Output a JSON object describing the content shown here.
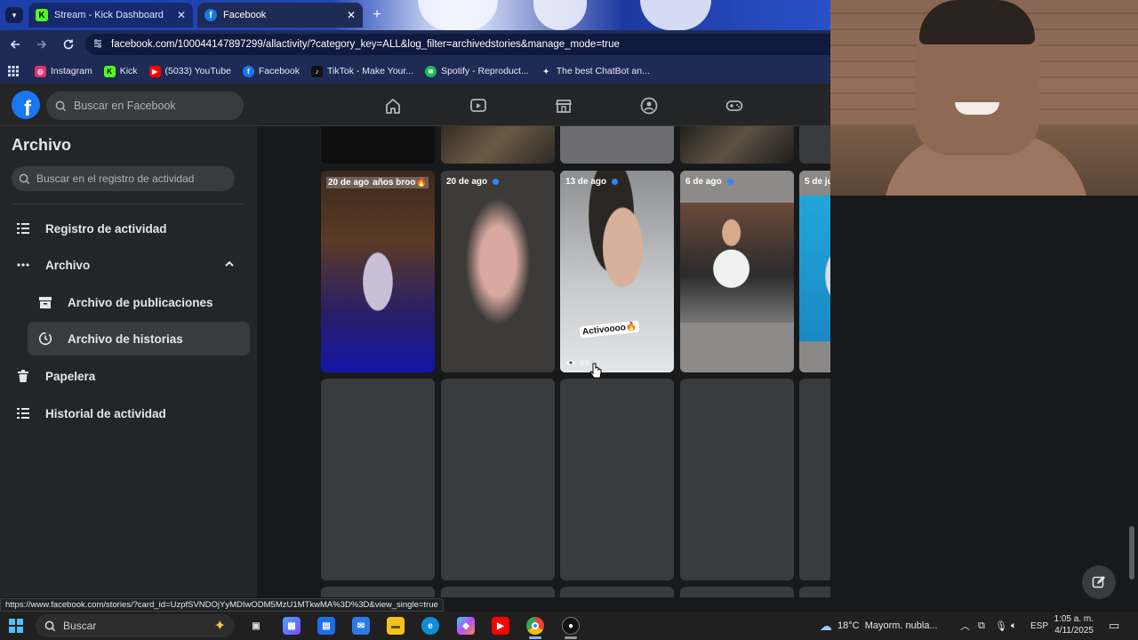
{
  "browser": {
    "tabs": [
      {
        "label": "Stream - Kick Dashboard",
        "active": false
      },
      {
        "label": "Facebook",
        "active": true
      }
    ],
    "url": "facebook.com/100044147897299/allactivity/?category_key=ALL&log_filter=archivedstories&manage_mode=true",
    "bookmarks": [
      {
        "label": "Instagram",
        "icon": "instagram-icon",
        "color": "#e1306c"
      },
      {
        "label": "Kick",
        "icon": "kick-icon",
        "color": "#53fc18"
      },
      {
        "label": "(5033) YouTube",
        "icon": "youtube-icon",
        "color": "#ff0000"
      },
      {
        "label": "Facebook",
        "icon": "facebook-icon",
        "color": "#1877f2"
      },
      {
        "label": "TikTok - Make Your...",
        "icon": "tiktok-icon",
        "color": "#111111"
      },
      {
        "label": "Spotify - Reproduct...",
        "icon": "spotify-icon",
        "color": "#1db954"
      },
      {
        "label": "The best ChatBot an...",
        "icon": "chatbot-icon",
        "color": "#444444"
      }
    ],
    "status_url": "https://www.facebook.com/stories/?card_id=UzpfSVNDOjYyMDIwODM5MzU1MTkwMA%3D%3D&view_single=true"
  },
  "facebook": {
    "search_placeholder": "Buscar en Facebook",
    "nav_icons": [
      "home-icon",
      "watch-icon",
      "marketplace-icon",
      "groups-icon",
      "gaming-icon"
    ],
    "accent": "#1877f2"
  },
  "sidebar": {
    "title": "Archivo",
    "search_placeholder": "Buscar en el registro de actividad",
    "items": [
      {
        "label": "Registro de actividad",
        "icon": "list-icon"
      },
      {
        "label": "Archivo",
        "icon": "more-icon"
      },
      {
        "label": "Archivo de publicaciones",
        "icon": "archive-box-icon"
      },
      {
        "label": "Archivo de historias",
        "icon": "history-clock-icon"
      },
      {
        "label": "Papelera",
        "icon": "trash-icon"
      },
      {
        "label": "Historial de actividad",
        "icon": "list-icon"
      }
    ]
  },
  "stories": [
    {
      "date": "20 de ago",
      "caption": "años broo🔥",
      "dot": true
    },
    {
      "date": "20 de ago",
      "caption": "",
      "dot": true
    },
    {
      "date": "13 de ago",
      "caption": "Activoooo🔥",
      "dot": true,
      "views": "99"
    },
    {
      "date": "6 de ago",
      "caption": "",
      "dot": true
    },
    {
      "date": "5 de ju",
      "caption": "",
      "dot": false
    }
  ],
  "taskbar": {
    "search_placeholder": "Buscar",
    "weather": "18°C  Mayorm. nubla...",
    "language": "ESP",
    "time": "1:05 a. m.",
    "date": "4/11/2025"
  }
}
